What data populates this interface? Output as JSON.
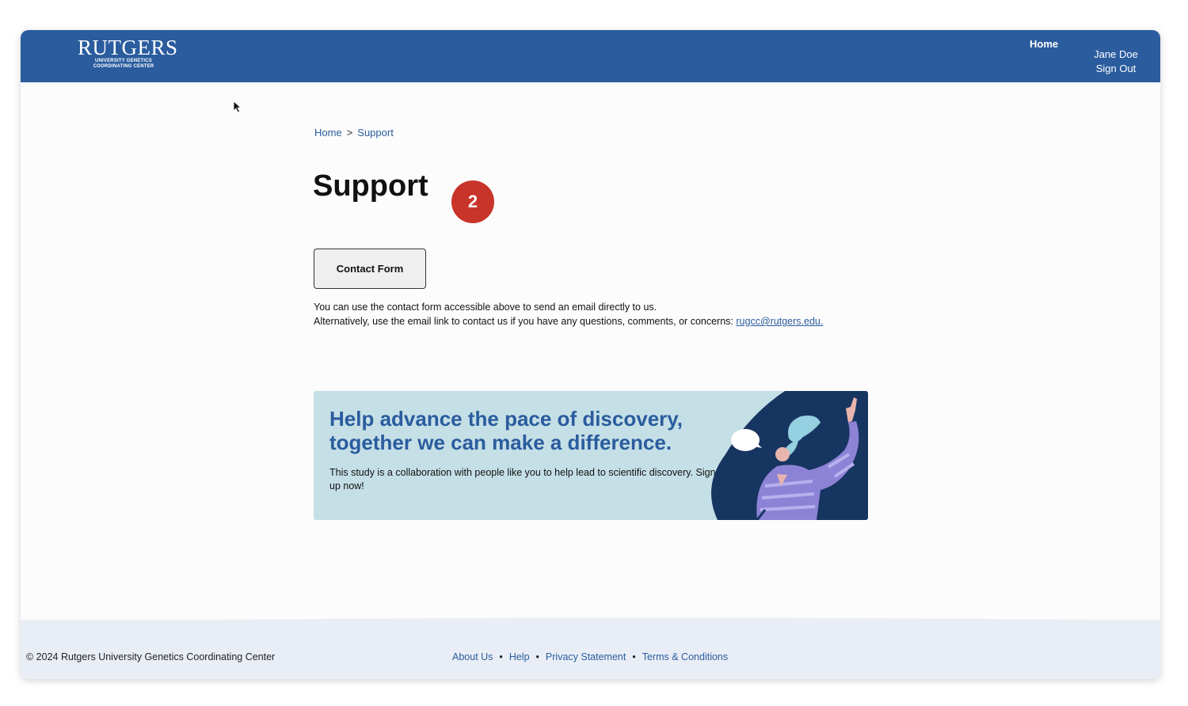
{
  "header": {
    "logo_main": "RUTGERS",
    "logo_sub_line1": "UNIVERSITY GENETICS",
    "logo_sub_line2": "COORDINATING CENTER",
    "nav_home": "Home",
    "user_name": "Jane Doe",
    "sign_out": "Sign Out",
    "brand_color": "#2a5c9e"
  },
  "breadcrumb": {
    "items": [
      "Home",
      "Support"
    ],
    "separator": ">"
  },
  "main": {
    "title": "Support",
    "badge": "2",
    "badge_color": "#c8342a",
    "contact_button": "Contact Form",
    "text_line1": "You can use the contact form accessible above to send an email directly to us.",
    "text_line2": "Alternatively, use the email link to contact us if you have any questions, comments, or concerns: ",
    "email_link": "rugcc@rutgers.edu."
  },
  "banner": {
    "title": "Help advance the pace of discovery, together we can make a difference.",
    "text": "This study is a collaboration with people like you to help lead to scientific discovery. Sign up now!",
    "background": "#c5dfe6",
    "illustration": "woman-waving-illustration"
  },
  "footer": {
    "copyright": "© 2024 Rutgers University Genetics Coordinating Center",
    "links": [
      "About Us",
      "Help",
      "Privacy Statement",
      "Terms & Conditions"
    ],
    "separator": "•"
  }
}
